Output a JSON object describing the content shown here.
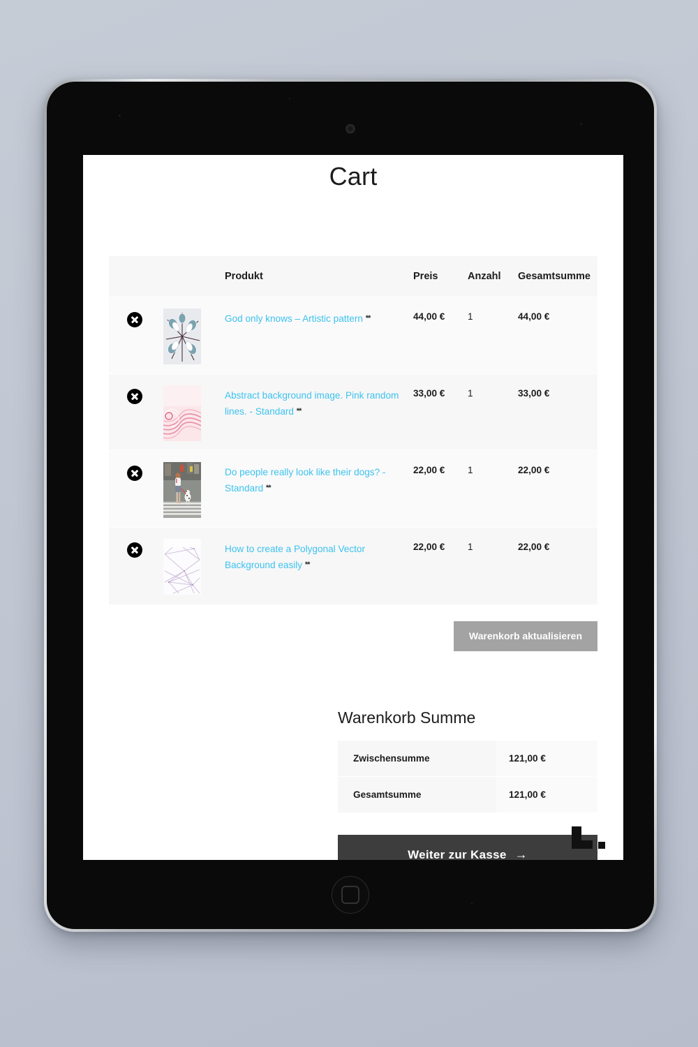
{
  "page": {
    "title": "Cart",
    "logo_icon": "l-mark-logo"
  },
  "cart_table": {
    "headers": {
      "remove": "",
      "thumbnail": "",
      "product": "Produkt",
      "price": "Preis",
      "quantity": "Anzahl",
      "subtotal": "Gesamtsumme"
    },
    "remove_icon": "close-circle-icon",
    "rows": [
      {
        "name": "God only knows – Artistic pattern",
        "stars": "**",
        "price": "44,00 €",
        "quantity": "1",
        "subtotal": "44,00 €",
        "thumb_icon": "artistic-bird-pattern-thumbnail"
      },
      {
        "name": "Abstract background image. Pink random lines. - Standard",
        "stars": "**",
        "price": "33,00 €",
        "quantity": "1",
        "subtotal": "33,00 €",
        "thumb_icon": "pink-abstract-lines-thumbnail"
      },
      {
        "name": "Do people really look like their dogs? - Standard",
        "stars": "**",
        "price": "22,00 €",
        "quantity": "1",
        "subtotal": "22,00 €",
        "thumb_icon": "woman-walking-dog-photo-thumbnail"
      },
      {
        "name": "How to create a Polygonal Vector Background easily",
        "stars": "**",
        "price": "22,00 €",
        "quantity": "1",
        "subtotal": "22,00 €",
        "thumb_icon": "polygonal-wireframe-thumbnail"
      }
    ]
  },
  "actions": {
    "update_cart": "Warenkorb aktualisieren"
  },
  "totals": {
    "heading": "Warenkorb Summe",
    "subtotal_label": "Zwischensumme",
    "subtotal_value": "121,00 €",
    "total_label": "Gesamtsumme",
    "total_value": "121,00 €",
    "checkout_label": "Weiter zur Kasse",
    "checkout_arrow": "→"
  },
  "colors": {
    "link": "#3cc2ef",
    "update_button_bg": "#a3a3a3",
    "checkout_button_bg": "#3d3d3d",
    "row_bg": "#fafafa",
    "header_bg": "#f7f7f7"
  }
}
